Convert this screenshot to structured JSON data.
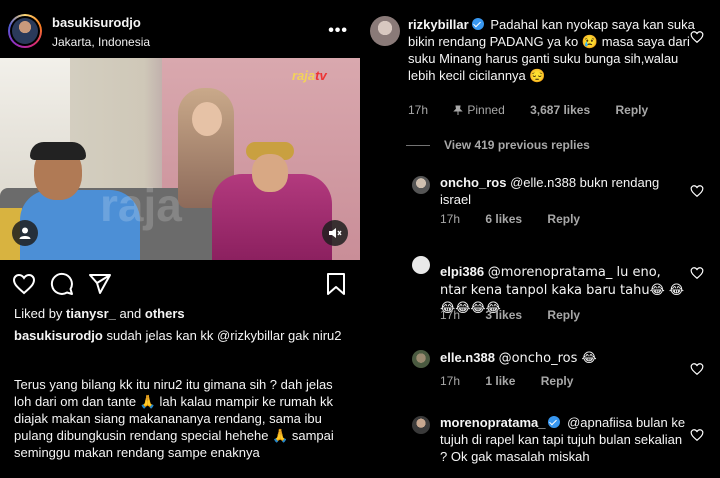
{
  "post": {
    "username": "basukisurodjo",
    "location": "Jakarta, Indonesia",
    "more": "•••",
    "image_logo": "raja",
    "image_logo_suffix": "tv",
    "image_watermark": "raja",
    "liked_prefix": "Liked by",
    "liked_user": "tianysr_",
    "liked_and": "and",
    "liked_others": "others",
    "caption_user": "basukisurodjo",
    "caption_first": "sudah jelas kan kk @rizkybillar gak niru2",
    "caption_body": "Terus yang bilang kk itu niru2 itu gimana sih ? dah jelas loh dari om dan tante 🙏 lah kalau mampir ke rumah kk diajak makan siang makanananya rendang, sama ibu pulang dibungkusin rendang special hehehe 🙏 sampai seminggu makan rendang sampe enaknya"
  },
  "comments": {
    "main": {
      "username": "rizkybillar",
      "text": "Padahal kan nyokap saya kan suka bikin rendang PADANG ya ko 😢 masa saya dari suku Minang harus ganti suku bunga sih,walau lebih kecil cicilannya 😔",
      "time": "17h",
      "pinned": "Pinned",
      "likes": "3,687 likes",
      "reply": "Reply"
    },
    "view_previous": "View 419 previous replies",
    "replies": [
      {
        "username": "oncho_ros",
        "text": "@elle.n388 bukn rendang israel",
        "time": "17h",
        "likes": "6 likes",
        "reply": "Reply"
      },
      {
        "username": "elpi386",
        "text": "@morenopratama_ lu eno, ntar kena tanpol kaka baru tahu😂 😂😂😂😂😂",
        "time": "17h",
        "likes": "3 likes",
        "reply": "Reply"
      },
      {
        "username": "elle.n388",
        "text": "@oncho_ros 😂",
        "time": "17h",
        "likes": "1 like",
        "reply": "Reply"
      },
      {
        "username": "morenopratama_",
        "text": "@apnafiisa bulan ke tujuh di rapel kan tapi tujuh bulan sekalian ? Ok gak masalah miskah",
        "time": "",
        "likes": "",
        "reply": ""
      }
    ]
  },
  "colors": {
    "background": "#000000",
    "text": "#f5f5f5",
    "muted": "#a8a8a8",
    "verified": "#3897f0"
  },
  "icons": [
    "heart-icon",
    "comment-icon",
    "share-icon",
    "bookmark-icon",
    "user-tag-icon",
    "mute-icon",
    "pin-icon",
    "verified-icon",
    "more-icon"
  ]
}
